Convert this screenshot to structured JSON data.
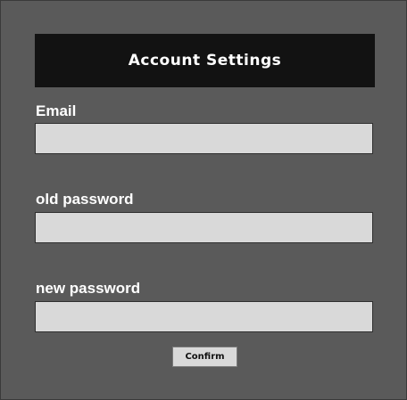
{
  "header": {
    "title": "Account Settings"
  },
  "form": {
    "email": {
      "label": "Email",
      "value": "",
      "placeholder": ""
    },
    "old_password": {
      "label": "old password",
      "value": "",
      "placeholder": ""
    },
    "new_password": {
      "label": "new password",
      "value": "",
      "placeholder": ""
    },
    "confirm_label": "Confirm"
  },
  "colors": {
    "background": "#5a5a5a",
    "header_background": "#121212",
    "input_background": "#d9d9d9",
    "button_background": "#d9d9d9",
    "label_text": "#ffffff"
  }
}
